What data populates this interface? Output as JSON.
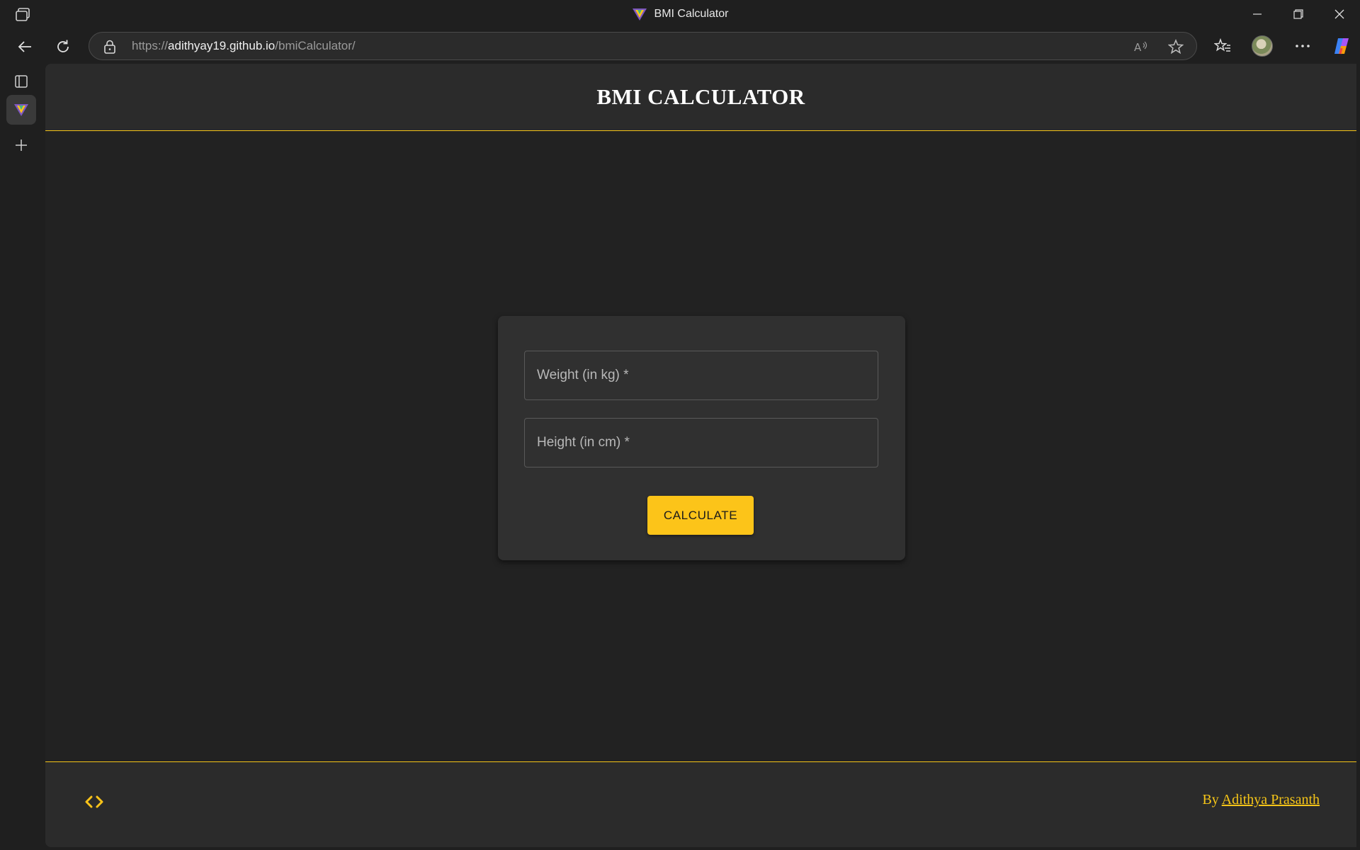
{
  "browser": {
    "window_title": "BMI Calculator",
    "url_scheme": "https://",
    "url_host": "adithyay19.github.io",
    "url_path": "/bmiCalculator/"
  },
  "page": {
    "title": "BMI CALCULATOR",
    "form": {
      "weight_label": "Weight (in kg) *",
      "height_label": "Height (in cm) *",
      "calculate_label": "CALCULATE"
    },
    "footer": {
      "credit_prefix": "By ",
      "author": "Adithya Prasanth"
    }
  },
  "colors": {
    "accent": "#fcc419",
    "background": "#222222",
    "card": "#303030",
    "header": "#2b2b2b"
  },
  "icons": [
    "tabs-icon",
    "back-icon",
    "refresh-icon",
    "lock-icon",
    "read-aloud-icon",
    "star-icon",
    "favorites-icon",
    "more-icon",
    "copilot-icon",
    "code-icon",
    "new-tab-icon"
  ]
}
